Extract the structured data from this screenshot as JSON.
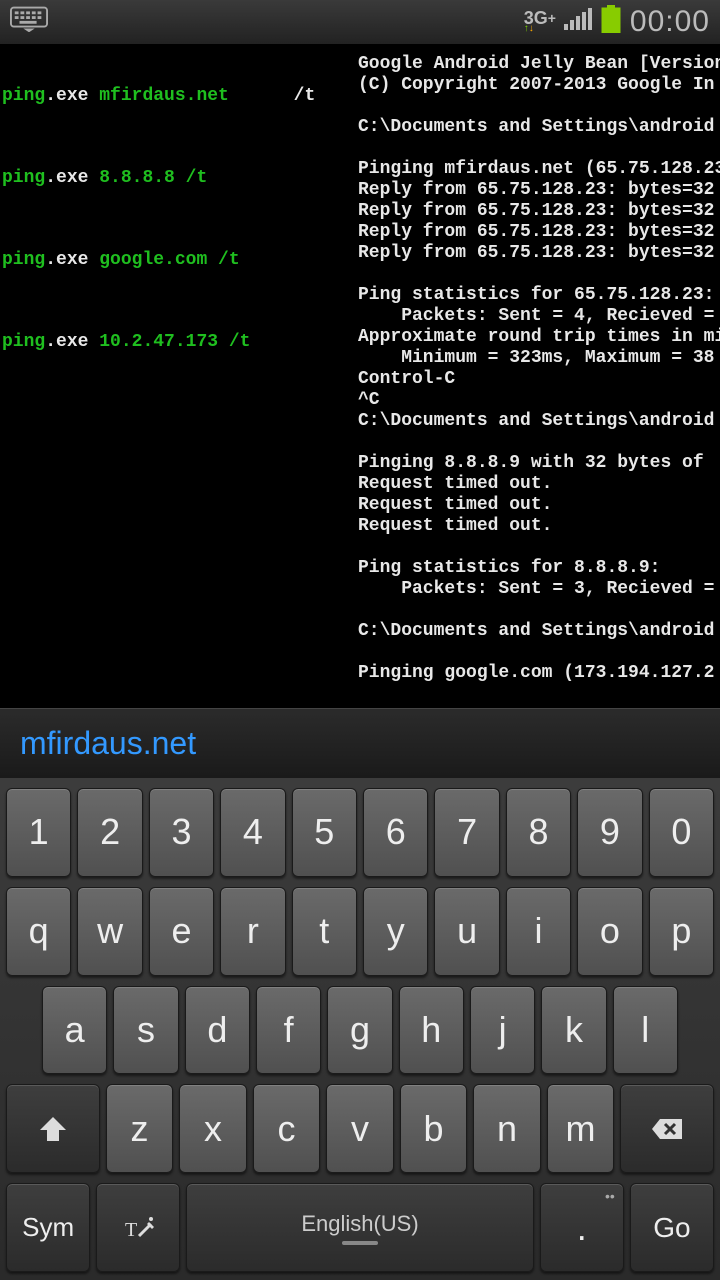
{
  "status": {
    "network": "3G",
    "network_plus": "+",
    "clock": "00:00"
  },
  "terminal": {
    "left_cmds": [
      {
        "cmd": "ping",
        "ext": ".exe ",
        "arg": "mfirdaus.net",
        "tail": "      /t"
      },
      {
        "cmd": "ping",
        "ext": ".exe ",
        "arg": "8.8.8.8 /t",
        "tail": ""
      },
      {
        "cmd": "ping",
        "ext": ".exe ",
        "arg": "google.com /t",
        "tail": ""
      },
      {
        "cmd": "ping",
        "ext": ".exe ",
        "arg": "10.2.47.173 /t",
        "tail": ""
      }
    ],
    "right_lines": [
      "Google Android Jelly Bean [Version",
      "(C) Copyright 2007-2013 Google In",
      "",
      "C:\\Documents and Settings\\android",
      "",
      "Pinging mfirdaus.net (65.75.128.23",
      "Reply from 65.75.128.23: bytes=32",
      "Reply from 65.75.128.23: bytes=32",
      "Reply from 65.75.128.23: bytes=32",
      "Reply from 65.75.128.23: bytes=32",
      "",
      "Ping statistics for 65.75.128.23:",
      "    Packets: Sent = 4, Recieved =",
      "Approximate round trip times in mi",
      "    Minimum = 323ms, Maximum = 38",
      "Control-C",
      "^C",
      "C:\\Documents and Settings\\android",
      "",
      "Pinging 8.8.8.9 with 32 bytes of ",
      "Request timed out.",
      "Request timed out.",
      "Request timed out.",
      "",
      "Ping statistics for 8.8.8.9:",
      "    Packets: Sent = 3, Recieved =",
      "",
      "C:\\Documents and Settings\\android",
      "",
      "Pinging google.com (173.194.127.2"
    ]
  },
  "suggestion": "mfirdaus.net",
  "keyboard": {
    "row1": [
      "1",
      "2",
      "3",
      "4",
      "5",
      "6",
      "7",
      "8",
      "9",
      "0"
    ],
    "row2": [
      "q",
      "w",
      "e",
      "r",
      "t",
      "y",
      "u",
      "i",
      "o",
      "p"
    ],
    "row3": [
      "a",
      "s",
      "d",
      "f",
      "g",
      "h",
      "j",
      "k",
      "l"
    ],
    "row4": [
      "z",
      "x",
      "c",
      "v",
      "b",
      "n",
      "m"
    ],
    "sym": "Sym",
    "space": "English(US)",
    "period": ".",
    "go": "Go"
  }
}
